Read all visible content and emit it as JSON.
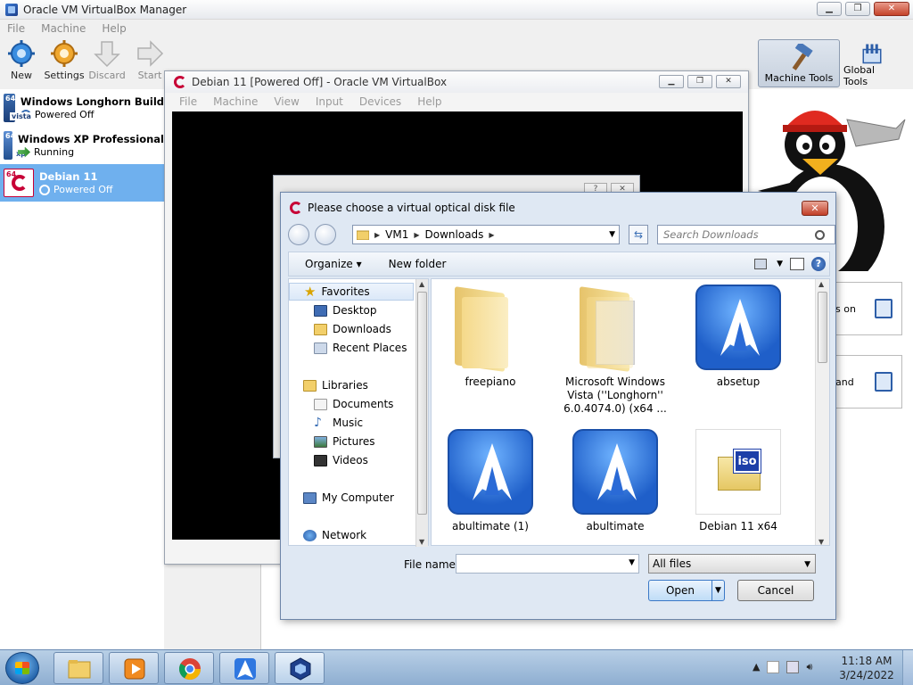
{
  "manager": {
    "title": "Oracle VM VirtualBox Manager",
    "menu": [
      "File",
      "Machine",
      "Help"
    ],
    "toolbar": {
      "new": "New",
      "settings": "Settings",
      "discard": "Discard",
      "start": "Start",
      "machine_tools": "Machine Tools",
      "global_tools": "Global Tools"
    },
    "vms": [
      {
        "name": "Windows Longhorn Build",
        "state": "Powered Off",
        "badge": "64",
        "os_label": "vista"
      },
      {
        "name": "Windows XP Professional",
        "state": "Running",
        "badge": "64",
        "os_label": "xp"
      },
      {
        "name": "Debian 11",
        "state": "Powered Off",
        "badge": "64",
        "os_label": ""
      }
    ],
    "side_cards": [
      "s on",
      "and"
    ]
  },
  "vm_window": {
    "title": "Debian 11 [Powered Off] - Oracle VM VirtualBox",
    "menu": [
      "File",
      "Machine",
      "View",
      "Input",
      "Devices",
      "Help"
    ]
  },
  "bg_dialog": {
    "help": "?",
    "close": "✕"
  },
  "file_dialog": {
    "title": "Please choose a virtual optical disk file",
    "close": "✕",
    "breadcrumb": [
      "VM1",
      "Downloads"
    ],
    "search_placeholder": "Search Downloads",
    "organize": "Organize",
    "new_folder": "New folder",
    "nav": {
      "favorites": "Favorites",
      "desktop": "Desktop",
      "downloads": "Downloads",
      "recent": "Recent Places",
      "libraries": "Libraries",
      "documents": "Documents",
      "music": "Music",
      "pictures": "Pictures",
      "videos": "Videos",
      "computer": "My Computer",
      "network": "Network"
    },
    "files": [
      {
        "name": "freepiano",
        "type": "folder"
      },
      {
        "name": "Microsoft Windows Vista (''Longhorn'' 6.0.4074.0) (x64 ...",
        "type": "folder-docs"
      },
      {
        "name": "absetup",
        "type": "avast"
      },
      {
        "name": "abultimate (1)",
        "type": "avast"
      },
      {
        "name": "abultimate",
        "type": "avast"
      },
      {
        "name": "Debian 11 x64",
        "type": "iso"
      }
    ],
    "iso_tag": "iso",
    "filename_label": "File name:",
    "filename_value": "",
    "filter": "All files",
    "open": "Open",
    "cancel": "Cancel"
  },
  "taskbar": {
    "time": "11:18 AM",
    "date": "3/24/2022"
  }
}
